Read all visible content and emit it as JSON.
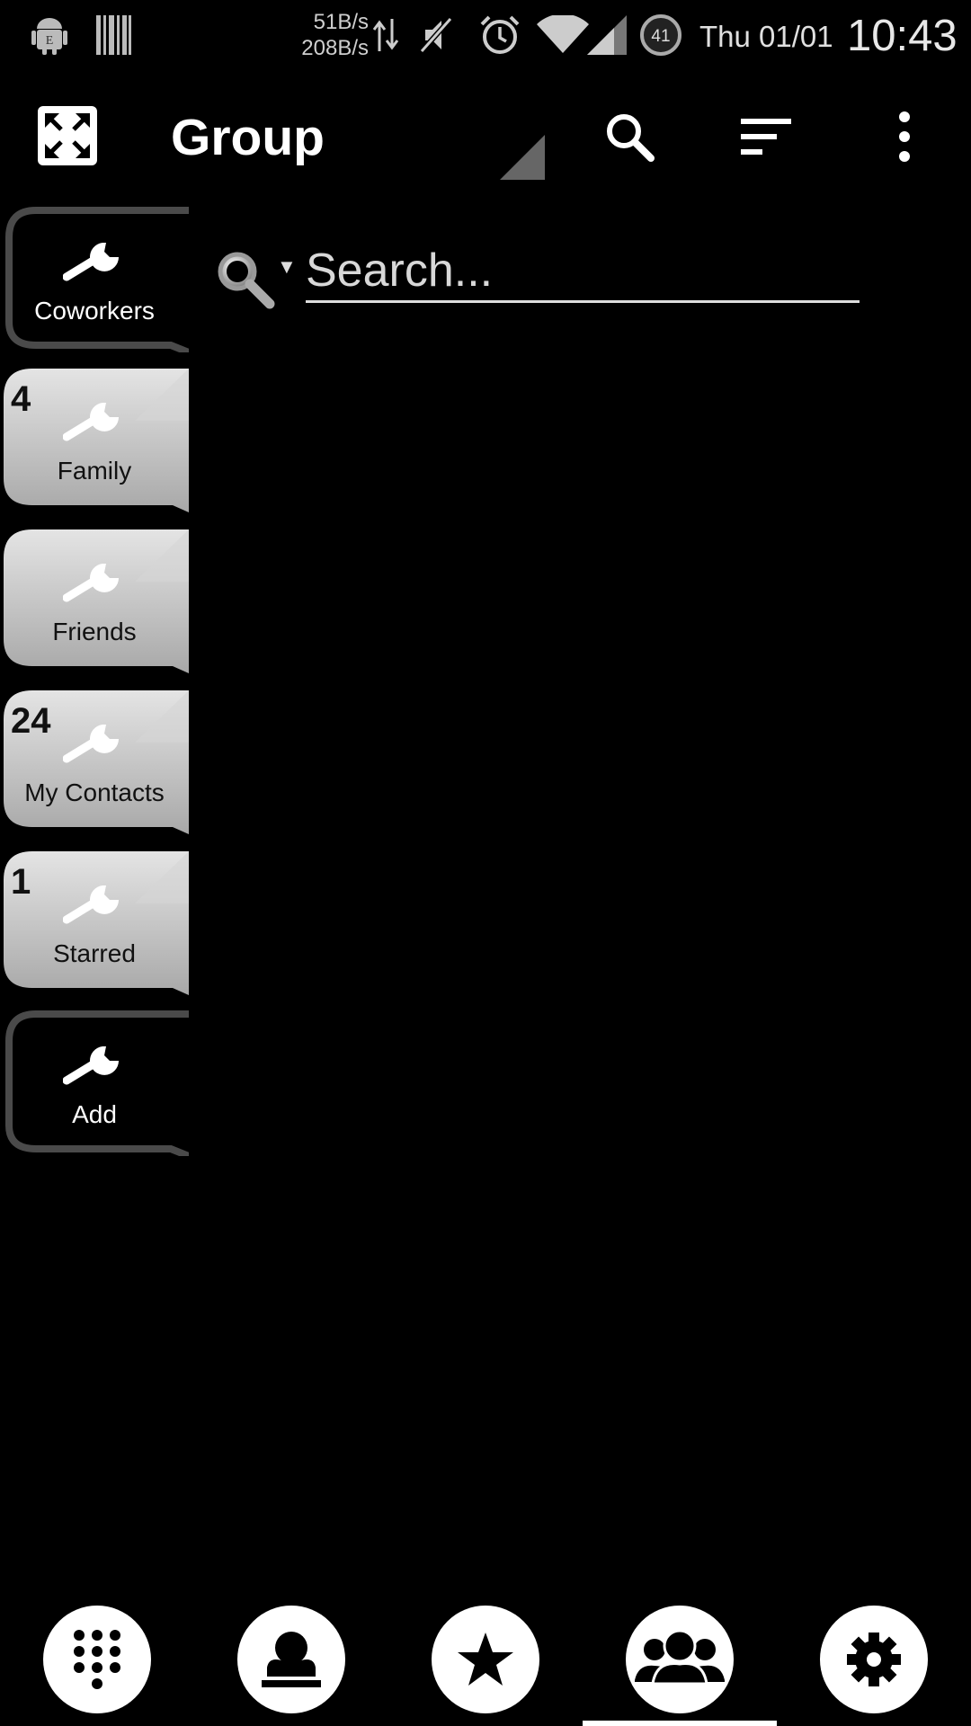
{
  "status_bar": {
    "net_up": "51B/s",
    "net_down": "208B/s",
    "battery_level": "41",
    "date": "Thu 01/01",
    "time": "10:43",
    "icons": [
      "android-icon",
      "barcode-icon",
      "data-transfer-icon",
      "mute-icon",
      "alarm-icon",
      "wifi-icon",
      "signal-icon",
      "battery-icon"
    ]
  },
  "action_bar": {
    "title": "Group",
    "icons": [
      "expand-icon",
      "search-icon",
      "sort-icon",
      "overflow-menu-icon"
    ]
  },
  "groups": [
    {
      "label": "Coworkers",
      "count": "",
      "style": "dark"
    },
    {
      "label": "Family",
      "count": "4",
      "style": "light"
    },
    {
      "label": "Friends",
      "count": "",
      "style": "light"
    },
    {
      "label": "My Contacts",
      "count": "24",
      "style": "light"
    },
    {
      "label": "Starred",
      "count": "1",
      "style": "light"
    },
    {
      "label": "Add",
      "count": "",
      "style": "dark"
    }
  ],
  "search": {
    "placeholder": "Search..."
  },
  "bottom_nav": {
    "items": [
      "dialpad-icon",
      "contact-icon",
      "star-icon",
      "groups-icon",
      "settings-icon"
    ],
    "active": "groups-icon"
  },
  "colors": {
    "background": "#000000",
    "tab_light": "#c8c8c8",
    "tab_dark_outline": "#4a4a4a",
    "foreground": "#ffffff"
  }
}
